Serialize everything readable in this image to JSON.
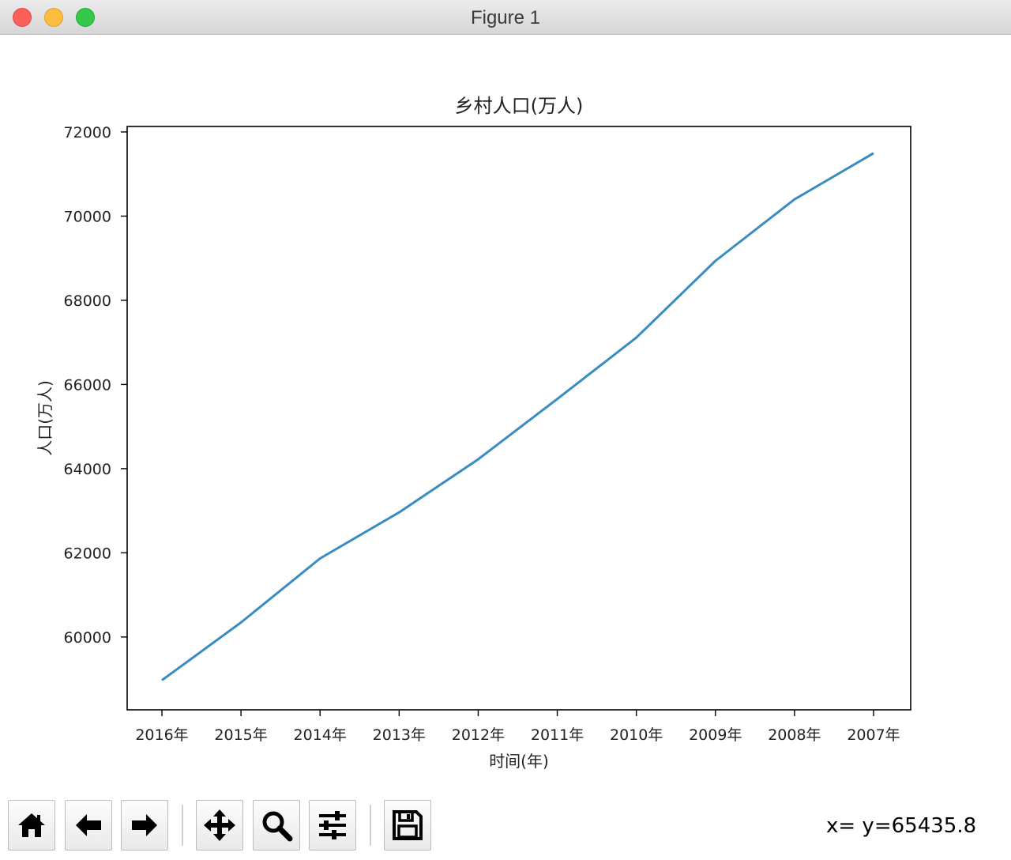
{
  "window": {
    "title": "Figure 1"
  },
  "toolbar": {
    "buttons": [
      {
        "name": "home-button",
        "icon": "home-icon"
      },
      {
        "name": "back-button",
        "icon": "arrow-left-icon"
      },
      {
        "name": "forward-button",
        "icon": "arrow-right-icon"
      },
      {
        "name": "pan-button",
        "icon": "move-icon"
      },
      {
        "name": "zoom-button",
        "icon": "magnifier-icon"
      },
      {
        "name": "configure-subplots-button",
        "icon": "sliders-icon"
      },
      {
        "name": "save-button",
        "icon": "floppy-disk-icon"
      }
    ],
    "coords": "x= y=65435.8"
  },
  "chart_data": {
    "type": "line",
    "title": "乡村人口(万人)",
    "xlabel": "时间(年)",
    "ylabel": "人口(万人)",
    "categories": [
      "2016年",
      "2015年",
      "2014年",
      "2013年",
      "2012年",
      "2011年",
      "2010年",
      "2009年",
      "2008年",
      "2007年"
    ],
    "series": [
      {
        "values": [
          58973,
          60346,
          61866,
          62961,
          64222,
          65656,
          67113,
          68938,
          70399,
          71496
        ],
        "color": "#3a8cc0"
      }
    ],
    "ylim": [
      58270,
      72130
    ],
    "yticks": [
      60000,
      62000,
      64000,
      66000,
      68000,
      70000,
      72000
    ],
    "grid": false
  }
}
